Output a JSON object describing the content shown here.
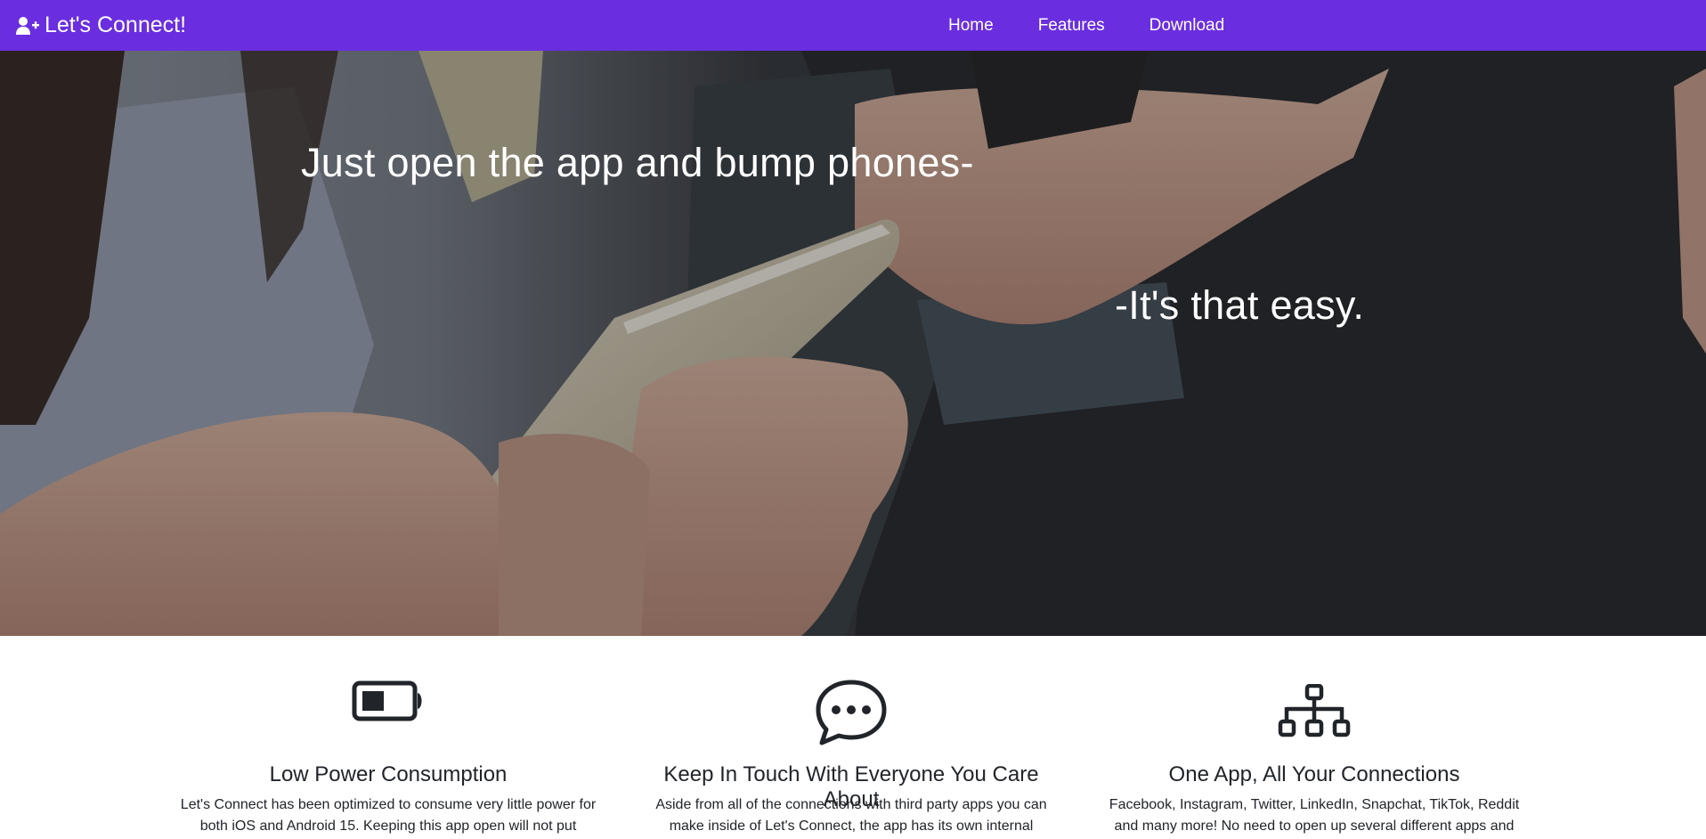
{
  "navbar": {
    "brand": "Let's Connect!",
    "brand_icon": "user-plus-icon",
    "links": [
      {
        "label": "Home"
      },
      {
        "label": "Features"
      },
      {
        "label": "Download"
      }
    ],
    "bg_color": "#6a2ee0"
  },
  "hero": {
    "line1": "Just open the app and bump phones-",
    "line2": "-It's that easy."
  },
  "features": [
    {
      "icon": "battery-icon",
      "title": "Low Power Consumption",
      "text": "Let's Connect has been optimized to consume very little power for both iOS and Android 15. Keeping this app open will not put"
    },
    {
      "icon": "chat-bubble-icon",
      "title": "Keep In Touch With Everyone You Care About",
      "text": "Aside from all of the connections with third party apps you can make inside of Let's Connect, the app has its own internal"
    },
    {
      "icon": "network-diagram-icon",
      "title": "One App, All Your Connections",
      "text": "Facebook, Instagram, Twitter, LinkedIn, Snapchat, TikTok, Reddit and many more! No need to open up several different apps and"
    }
  ]
}
